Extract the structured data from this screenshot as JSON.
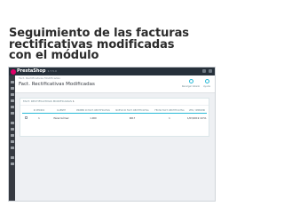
{
  "headline": {
    "lines": [
      "Seguimiento de las facturas",
      "rectificativas modificadas",
      "con el módulo"
    ]
  },
  "app": {
    "logo_text": "PrestaShop",
    "version": "1.7.5.0"
  },
  "header": {
    "breadcrumb": "Fact. Rectificativas Modificadas",
    "title": "Fact. Rectificativas Modificadas",
    "buttons": [
      {
        "label": "Recargar listado"
      },
      {
        "label": "Ayuda"
      }
    ]
  },
  "panel": {
    "title": "Fact. Rectificativas Modificadas",
    "count": "1"
  },
  "table": {
    "columns": [
      "",
      "ID PEDIDO",
      "CLIENTE",
      "PRIMER ID FACT. RECTIFICATIVA",
      "NUEVO ID FACT. RECTIFICATIVA",
      "FECHA FACT. RECTIFICATIVA",
      "Ver / Imprimir"
    ],
    "rows": [
      [
        "",
        "1",
        "Pérez Gómez",
        "1.000",
        "9617",
        "1",
        "1/03/2019 10:51:12"
      ]
    ]
  }
}
